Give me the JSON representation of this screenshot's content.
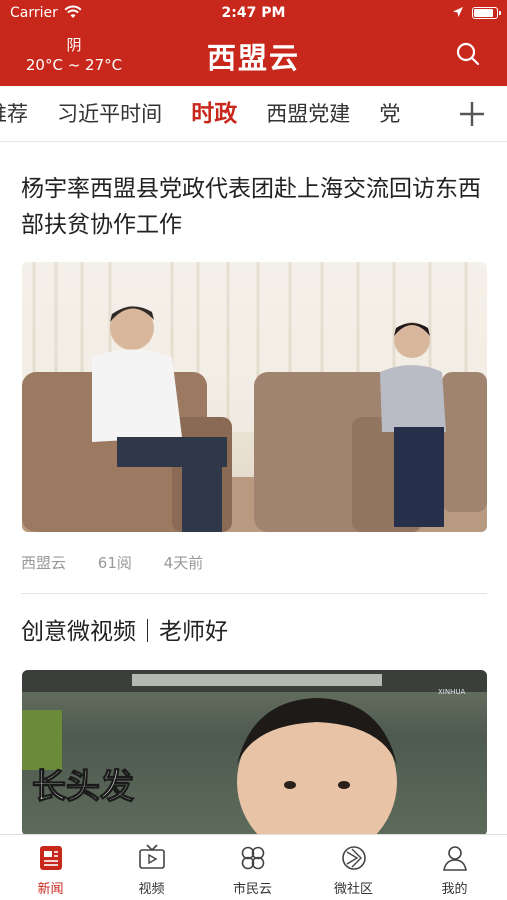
{
  "status_bar": {
    "carrier": "Carrier",
    "time": "2:47 PM",
    "battery_level": 0.9
  },
  "header": {
    "weather_condition": "阴",
    "temperature": "20°C ~ 27°C",
    "app_title": "西盟云",
    "search_icon": "search-icon"
  },
  "tabs": {
    "items": [
      "推荐",
      "习近平时间",
      "时政",
      "西盟党建",
      "党"
    ],
    "active_index": 2,
    "add_icon": "plus-icon"
  },
  "articles": [
    {
      "title": "杨宇率西盟县党政代表团赴上海交流回访东西部扶贫协作工作",
      "source": "西盟云",
      "reads": "61阅",
      "time": "4天前"
    },
    {
      "title": "创意微视频｜老师好",
      "video_overlay_text": "长头发",
      "video_logo": "XINHUA"
    }
  ],
  "bottom_nav": {
    "items": [
      {
        "label": "新闻",
        "icon": "news-icon",
        "active": true
      },
      {
        "label": "视频",
        "icon": "tv-icon",
        "active": false
      },
      {
        "label": "市民云",
        "icon": "clover-icon",
        "active": false
      },
      {
        "label": "微社区",
        "icon": "community-icon",
        "active": false
      },
      {
        "label": "我的",
        "icon": "user-icon",
        "active": false
      }
    ]
  },
  "colors": {
    "brand": "#c8281c",
    "text": "#222222",
    "meta": "#999999"
  }
}
